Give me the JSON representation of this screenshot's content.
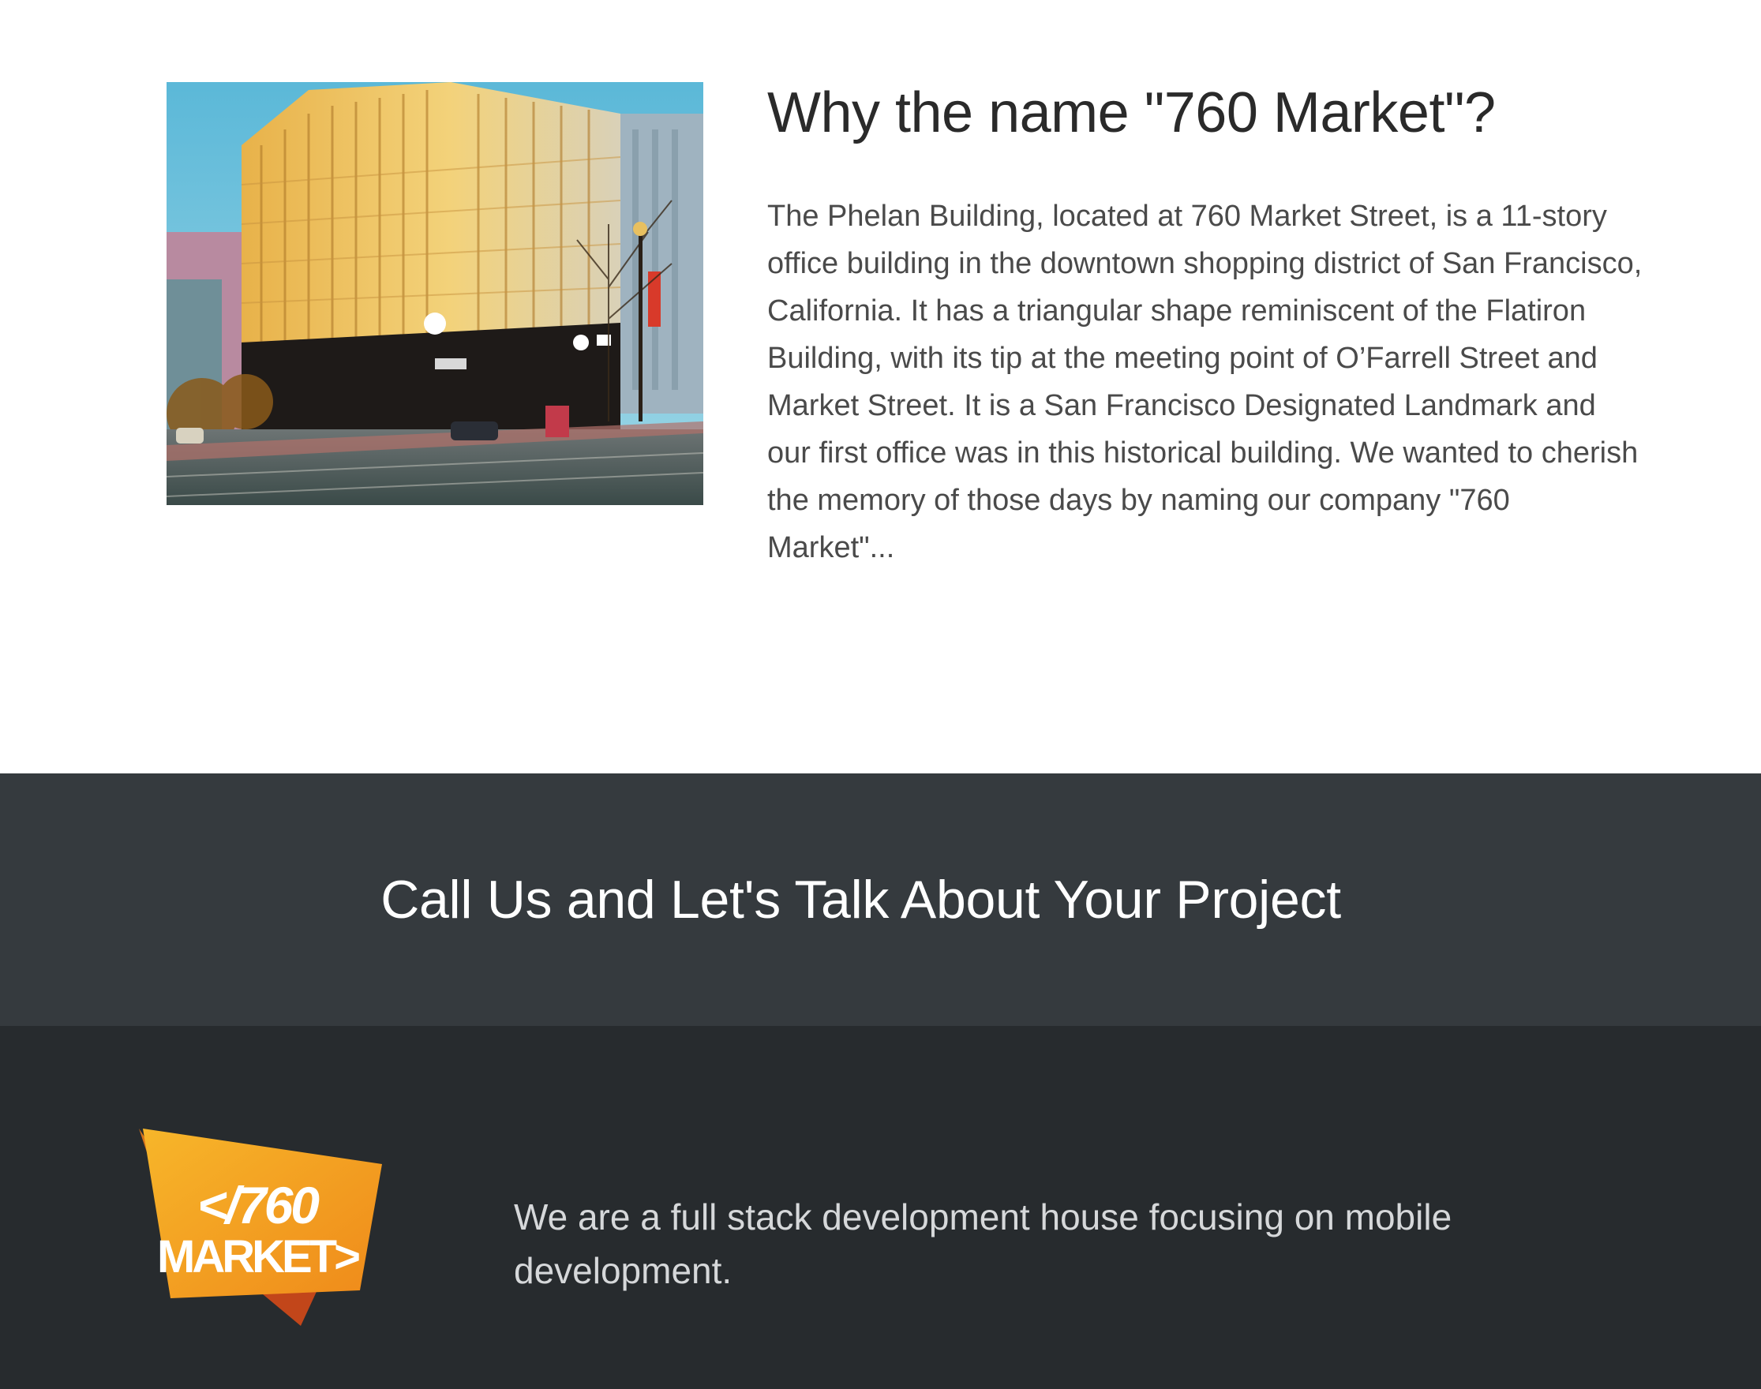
{
  "about": {
    "title": "Why the name \"760 Market\"?",
    "paragraph": "The Phelan Building, located at 760 Market Street, is a 11-story office building in the downtown shopping district of San Francisco, California. It has a triangular shape reminiscent of the Flatiron Building, with its tip at the meeting point of O’Farrell Street and Market Street. It is a San Francisco Designated Landmark and our first office was in this historical building. We wanted to cherish the memory of those days by naming our company \"760 Market\"..."
  },
  "cta": {
    "title": "Call Us and Let's Talk About Your Project"
  },
  "footer": {
    "logo": {
      "line1": "</760",
      "line2": "MARKET>"
    },
    "tagline": "We are a full stack development house focusing on mobile development."
  },
  "colors": {
    "cta_background": "#353a3e",
    "footer_background": "#272b2e",
    "logo_orange": "#f39a1e",
    "logo_dark_orange": "#d4541a"
  },
  "icons": {
    "building_photo": "phelan-building-photo",
    "logo": "760-market-logo"
  }
}
